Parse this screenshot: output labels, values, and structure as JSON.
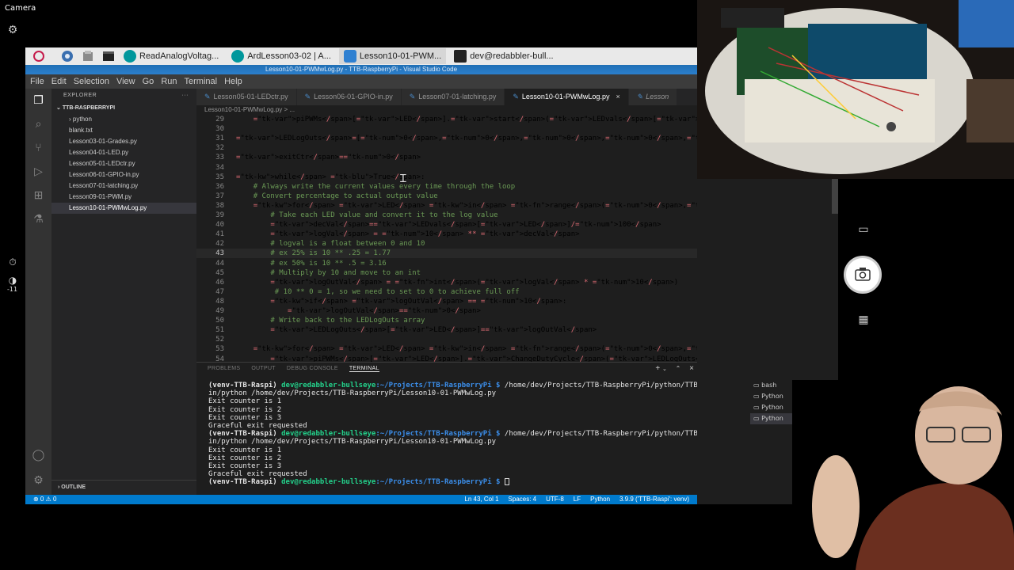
{
  "camera": {
    "title": "Camera",
    "exposure_value": "-11"
  },
  "taskbar": {
    "items": [
      {
        "label": "ReadAnalogVoltag...",
        "color": "#00979c"
      },
      {
        "label": "ArdLesson03-02 | A...",
        "color": "#00979c"
      },
      {
        "label": "Lesson10-01-PWM...",
        "color": "#2f80d1"
      },
      {
        "label": "dev@redabbler-bull...",
        "color": "#222222"
      }
    ]
  },
  "vscode": {
    "title": "Lesson10-01-PWMwLog.py - TTB-RaspberryPi - Visual Studio Code",
    "menu": [
      "File",
      "Edit",
      "Selection",
      "View",
      "Go",
      "Run",
      "Terminal",
      "Help"
    ],
    "explorer": {
      "header": "EXPLORER",
      "root": "TTB-RASPBERRYPI",
      "items": [
        "python",
        "blank.txt",
        "Lesson03-01-Grades.py",
        "Lesson04-01-LED.py",
        "Lesson05-01-LEDctr.py",
        "Lesson06-01-GPIO-in.py",
        "Lesson07-01-latching.py",
        "Lesson09-01-PWM.py",
        "Lesson10-01-PWMwLog.py"
      ],
      "outline": "OUTLINE"
    },
    "tabs": [
      "Lesson05-01-LEDctr.py",
      "Lesson06-01-GPIO-in.py",
      "Lesson07-01-latching.py",
      "Lesson10-01-PWMwLog.py",
      "Lesson"
    ],
    "breadcrumb": "Lesson10-01-PWMwLog.py > ...",
    "code": [
      {
        "n": "29",
        "t": "    piPWMs[LED].start(LEDvals[LED])"
      },
      {
        "n": "30",
        "t": ""
      },
      {
        "n": "31",
        "t": "LEDLogOuts=[0,0,0,0,0]"
      },
      {
        "n": "32",
        "t": ""
      },
      {
        "n": "33",
        "t": "exitCtr=0"
      },
      {
        "n": "34",
        "t": ""
      },
      {
        "n": "35",
        "t": "while True:"
      },
      {
        "n": "36",
        "t": "    # Always write the current values every time through the loop"
      },
      {
        "n": "37",
        "t": "    # Convert percentage to actual output value"
      },
      {
        "n": "38",
        "t": "    for LED in range(0,5,1):"
      },
      {
        "n": "39",
        "t": "        # Take each LED value and convert it to the log value"
      },
      {
        "n": "40",
        "t": "        decVal=LEDvals[LED]/100"
      },
      {
        "n": "41",
        "t": "        logVal = 10 ** decVal"
      },
      {
        "n": "42",
        "t": "        # logval is a float between 0 and 10"
      },
      {
        "n": "43",
        "t": "        # ex 25% is 10 ** .25 = 1.77"
      },
      {
        "n": "44",
        "t": "        # ex 50% is 10 ** .5 = 3.16"
      },
      {
        "n": "45",
        "t": "        # Multiply by 10 and move to an int"
      },
      {
        "n": "46",
        "t": "        logOutVal = int(logVal * 10)"
      },
      {
        "n": "47",
        "t": "         # 10 ** 0 = 1, so we need to set to 0 to achieve full off"
      },
      {
        "n": "48",
        "t": "        if logOutVal == 10:"
      },
      {
        "n": "49",
        "t": "            logOutVal=0"
      },
      {
        "n": "50",
        "t": "        # Write back to the LEDLogOuts array"
      },
      {
        "n": "51",
        "t": "        LEDLogOuts[LED]=logOutVal"
      },
      {
        "n": "52",
        "t": ""
      },
      {
        "n": "53",
        "t": "    for LED in range(0,5,1):"
      },
      {
        "n": "54",
        "t": "        piPWMs[LED].ChangeDutyCycle(LEDLogOuts[LED])"
      }
    ],
    "panel_tabs": [
      "PROBLEMS",
      "OUTPUT",
      "DEBUG CONSOLE",
      "TERMINAL"
    ],
    "terminal": {
      "venv": "(venv-TTB-Raspi)",
      "user": "dev@redabbler-bullseye",
      "path": ":~/Projects/TTB-RaspberryPi $",
      "command": " /home/dev/Projects/TTB-RaspberryPi/python/TTB-Raspi/b",
      "command2": "in/python /home/dev/Projects/TTB-RaspberryPi/Lesson10-01-PWMwLog.py",
      "out1": "Exit counter is 1",
      "out2": "Exit counter is 2",
      "out3": "Exit counter is 3",
      "out4": "Graceful exit requested"
    },
    "terminal_list": [
      "bash",
      "Python",
      "Python",
      "Python"
    ],
    "status": {
      "left": "⊗ 0 ⚠ 0",
      "items": [
        "Ln 43, Col 1",
        "Spaces: 4",
        "UTF-8",
        "LF",
        "Python",
        "3.9.9 ('TTB-Raspi': venv)"
      ]
    }
  }
}
